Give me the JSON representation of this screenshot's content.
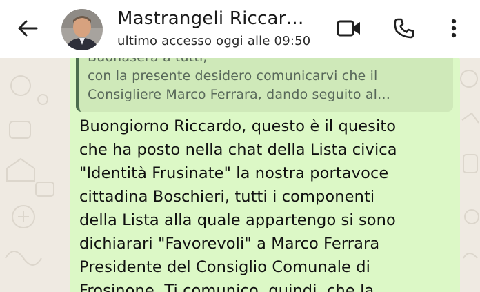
{
  "header": {
    "contact_name": "Mastrangeli Riccar…",
    "last_seen": "ultimo accesso oggi alle 09:50",
    "icons": {
      "back": "arrow-left-icon",
      "video": "video-camera-icon",
      "call": "phone-icon",
      "more": "more-vertical-icon"
    }
  },
  "quoted_message": {
    "lines": [
      "Buonasera a tutti,",
      "con la presente desidero comunicarvi che il",
      "Consigliere Marco Ferrara, dando seguito al…"
    ]
  },
  "message": {
    "lines": [
      "Buongiorno Riccardo, questo è il quesito",
      "che ha posto nella chat della Lista civica",
      "\"Identità Frusinate\" la nostra portavoce",
      "cittadina Boschieri, tutti i componenti",
      "della Lista alla quale appartengo si sono",
      "dichiarari \"Favorevoli\" a Marco Ferrara",
      "Presidente del Consiglio Comunale di",
      "Frosinone. Ti comunico, quindi, che la"
    ]
  },
  "colors": {
    "header_bg": "#ffffff",
    "chat_bg": "#efeae2",
    "bubble_bg": "#dcf8c6",
    "quote_bg": "#cfe9b9",
    "quote_bar": "#4c6e4e"
  }
}
